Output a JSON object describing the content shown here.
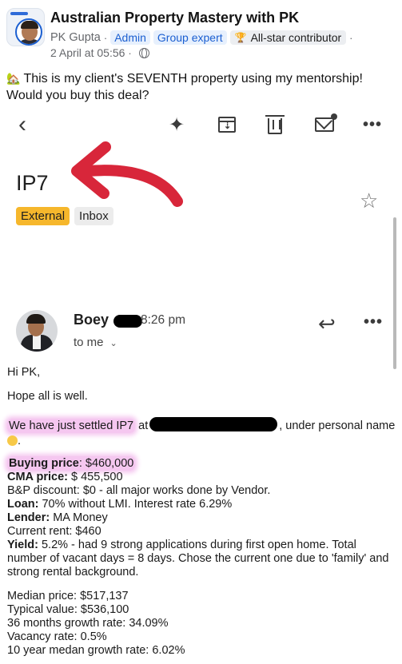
{
  "post": {
    "group_name": "Australian Property Mastery with PK",
    "author": "PK Gupta",
    "badges": [
      "Admin",
      "Group expert",
      "All-star contributor"
    ],
    "timestamp": "2 April at 05:56",
    "text_line1": "This is my client's SEVENTH property using my mentorship!",
    "text_line2": "Would you buy this deal?"
  },
  "email": {
    "subject": "IP7",
    "labels": [
      "External",
      "Inbox"
    ],
    "sender_name": "Boey",
    "sender_time": "8:26 pm",
    "to_me": "to me",
    "greeting": "Hi PK,",
    "opening": "Hope all is well.",
    "settled_highlight": "We have just settled IP7",
    "settled_at": "at",
    "settled_rest": ", under personal name",
    "buying_price_label": "Buying price",
    "buying_price_value": ": $460,000",
    "cma_label": "CMA price:",
    "cma_value": " $ 455,500",
    "bp_discount": "B&P discount: $0 - all major works done by Vendor.",
    "loan_label": "Loan:",
    "loan_value": " 70% without LMI. Interest rate 6.29%",
    "lender_label": "Lender:",
    "lender_value": " MA Money",
    "current_rent": "Current rent: $460",
    "yield_label": "Yield:",
    "yield_value": " 5.2% - had 9 strong applications during first open home. Total number of vacant days = 8 days. Chose the current one due to 'family' and strong rental background.",
    "median_price": "Median price: $517,137",
    "typical_value": "Typical value: $536,100",
    "growth_36": "36 months growth rate: 34.09%",
    "vacancy": "Vacancy rate: 0.5%",
    "growth_10yr": "10 year medan growth rate: 6.02%"
  },
  "icons": [
    "back-icon",
    "sparkle-icon",
    "archive-icon",
    "trash-icon",
    "mark-unread-icon",
    "more-icon",
    "star-icon",
    "reply-icon",
    "globe-icon",
    "trophy-icon"
  ],
  "colors": {
    "admin_blue": "#1b5fd1",
    "external_label": "#f6b72c",
    "highlight_pink": "#f5c7f0",
    "arrow_red": "#d8263a"
  }
}
